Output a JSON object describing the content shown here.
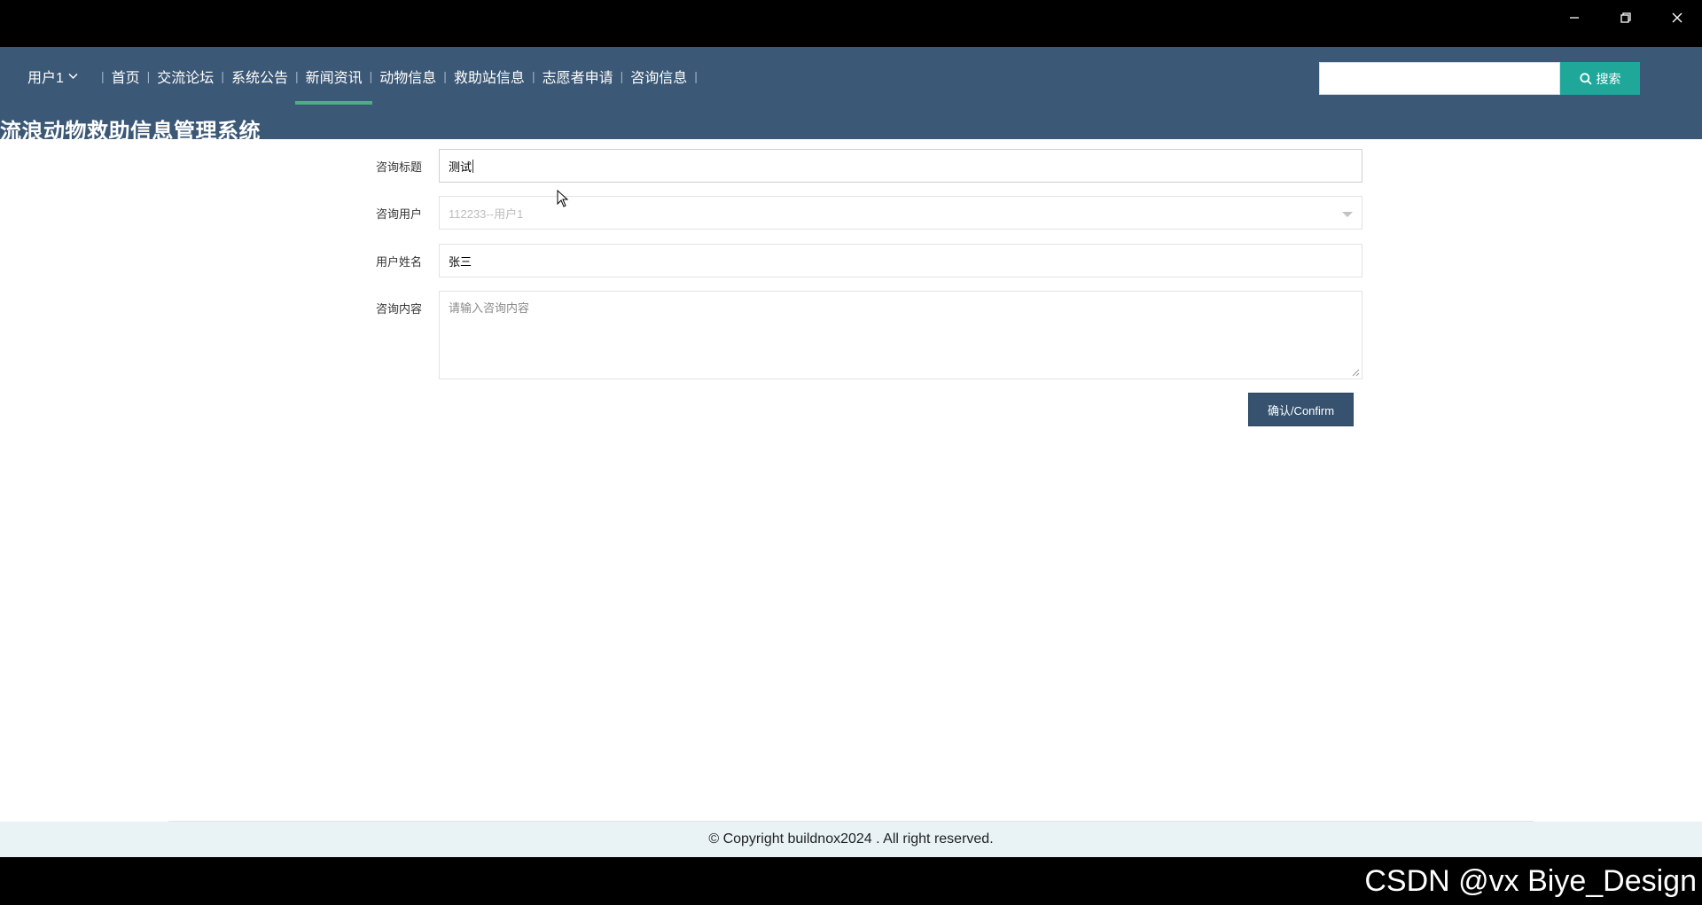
{
  "window": {
    "minimize_icon": "minimize-icon",
    "restore_icon": "restore-icon",
    "close_icon": "close-icon"
  },
  "nav": {
    "user_menu_label": "用户1",
    "items": [
      "首页",
      "交流论坛",
      "系统公告",
      "新闻资讯",
      "动物信息",
      "救助站信息",
      "志愿者申请",
      "咨询信息"
    ],
    "active_item": "新闻资讯",
    "search_value": "",
    "search_button_label": "搜索",
    "site_title": "流浪动物救助信息管理系统"
  },
  "form": {
    "title_label": "咨询标题",
    "title_value": "测试",
    "user_label": "咨询用户",
    "user_value": "112233--用户1",
    "name_label": "用户姓名",
    "name_value": "张三",
    "content_label": "咨询内容",
    "content_placeholder": "请输入咨询内容",
    "confirm_label": "确认/Confirm"
  },
  "footer": {
    "copyright": "© Copyright buildnox2024 . All right reserved."
  },
  "watermark": "CSDN @vx Biye_Design",
  "colors": {
    "nav_bg": "#3b5876",
    "search_button": "#1fa79a",
    "active_underline": "#4caf82",
    "confirm_button": "#36526f",
    "footer_bg": "#e9f3f6"
  }
}
